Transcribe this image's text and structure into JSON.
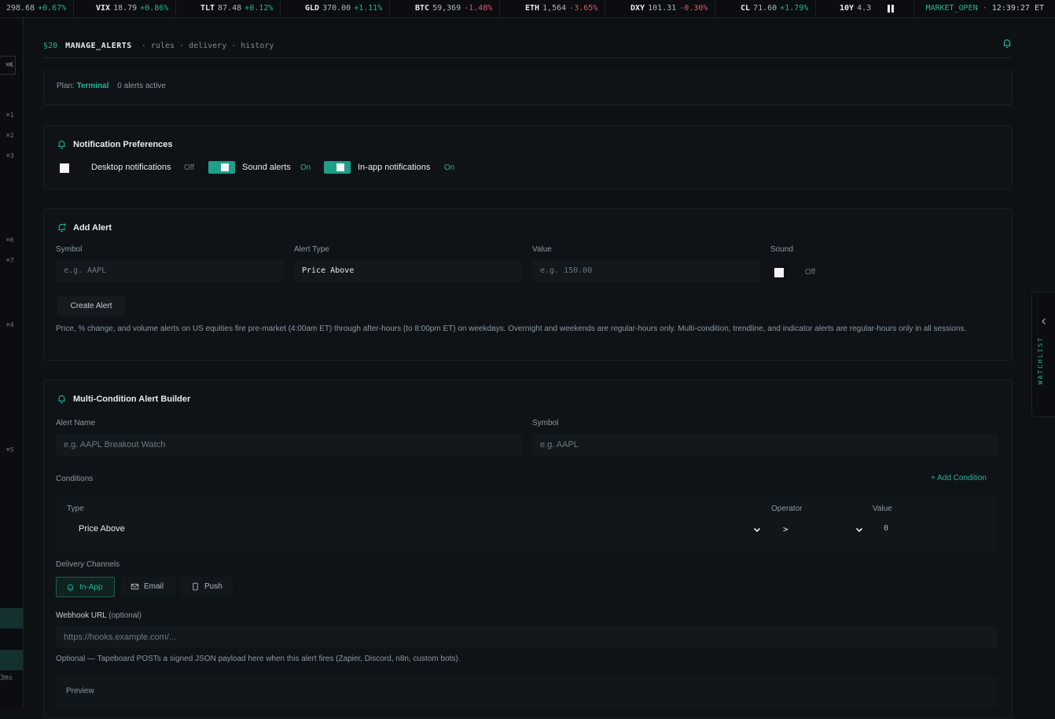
{
  "ticker": [
    {
      "sym": "",
      "px": "298.68",
      "chg": "+0.67%",
      "dir": "up"
    },
    {
      "sym": "VIX",
      "px": "18.79",
      "chg": "+0.86%",
      "dir": "up"
    },
    {
      "sym": "TLT",
      "px": "87.48",
      "chg": "+0.12%",
      "dir": "up"
    },
    {
      "sym": "GLD",
      "px": "370.00",
      "chg": "+1.11%",
      "dir": "up"
    },
    {
      "sym": "BTC",
      "px": "59,369",
      "chg": "-1.48%",
      "dir": "dn"
    },
    {
      "sym": "ETH",
      "px": "1,564",
      "chg": "-3.65%",
      "dir": "dn"
    },
    {
      "sym": "DXY",
      "px": "101.31",
      "chg": "-0.30%",
      "dir": "dn"
    },
    {
      "sym": "CL",
      "px": "71.60",
      "chg": "+1.79%",
      "dir": "up"
    },
    {
      "sym": "10Y",
      "px": "4.3",
      "chg": "",
      "dir": "up"
    }
  ],
  "market": {
    "status": "MARKET_OPEN",
    "dot": "·",
    "clock": "12:39:27 ET"
  },
  "rail": {
    "top_label": "⌘K",
    "keys": [
      "⌘1",
      "⌘2",
      "⌘3",
      "⌘6",
      "⌘7",
      "⌘4",
      "⌘5"
    ],
    "latency": "3ms"
  },
  "header": {
    "code": "§20",
    "title": "MANAGE_ALERTS",
    "tabs": "· rules · delivery · history"
  },
  "plan": {
    "label": "Plan:",
    "name": "Terminal",
    "count": "0 alerts active"
  },
  "notif": {
    "title": "Notification Preferences",
    "desktop_label": "Desktop notifications",
    "desktop_state": "Off",
    "sound_label": "Sound alerts",
    "sound_state": "On",
    "inapp_label": "In-app notifications",
    "inapp_state": "On"
  },
  "add_alert": {
    "title": "Add Alert",
    "symbol_label": "Symbol",
    "symbol_placeholder": "e.g. AAPL",
    "type_label": "Alert Type",
    "type_value": "Price Above",
    "value_label": "Value",
    "value_placeholder": "e.g. 150.00",
    "sound_label": "Sound",
    "sound_state": "Off",
    "create_label": "Create Alert",
    "note": "Price, % change, and volume alerts on US equities fire pre-market (4:00am ET) through after-hours (to 8:00pm ET) on weekdays. Overnight and weekends are regular-hours only. Multi-condition, trendline, and indicator alerts are regular-hours only in all sessions."
  },
  "multi": {
    "title": "Multi-Condition Alert Builder",
    "name_label": "Alert Name",
    "name_placeholder": "e.g. AAPL Breakout Watch",
    "symbol_label": "Symbol",
    "symbol_placeholder": "e.g. AAPL",
    "conditions_label": "Conditions",
    "add_condition": "+ Add Condition",
    "cond_type_label": "Type",
    "cond_type_value": "Price Above",
    "operator_label": "Operator",
    "operator_value": ">",
    "cond_value_label": "Value",
    "cond_value": "0",
    "delivery_label": "Delivery Channels",
    "channels": [
      "In-App",
      "Email",
      "Push"
    ],
    "webhook_label": "Webhook URL",
    "webhook_optional": "(optional)",
    "webhook_placeholder": "https://hooks.example.com/...",
    "webhook_note": "Optional — Tapeboard POSTs a signed JSON payload here when this alert fires (Zapier, Discord, n8n, custom bots).",
    "preview_label": "Preview"
  },
  "watchlist": {
    "label": "WATCHLIST"
  },
  "colors": {
    "accent": "#22b39a",
    "down": "#e0566a",
    "bg": "#0e1114",
    "card": "#0f1317"
  },
  "icons": [
    "bell-icon",
    "pause-icon",
    "chevron-down-icon",
    "chevron-left-icon",
    "mail-icon",
    "phone-icon",
    "plus-icon"
  ]
}
